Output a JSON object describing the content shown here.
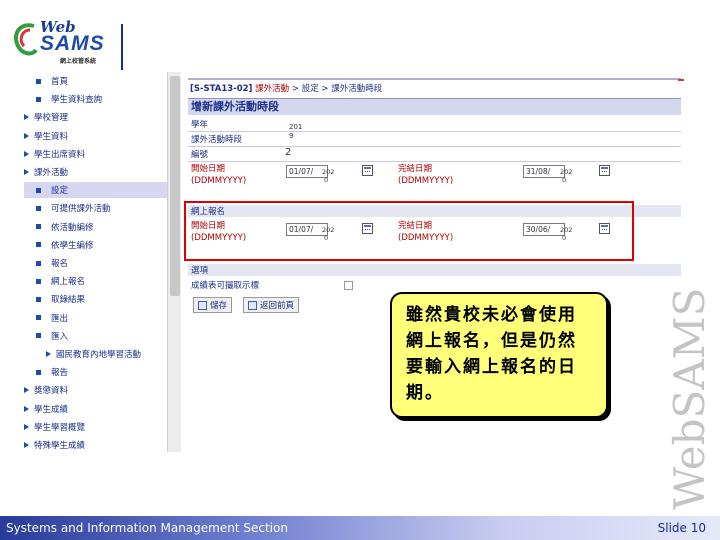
{
  "logo": {
    "web": "Web",
    "sams": "SAMS",
    "sub": "網上校管系統"
  },
  "sidebar": {
    "items": [
      {
        "label": "首頁",
        "marker": "square",
        "indent": 1
      },
      {
        "label": "學生資料查詢",
        "marker": "square",
        "indent": 1
      },
      {
        "label": "學校管理",
        "marker": "triangle",
        "indent": 0
      },
      {
        "label": "學生資料",
        "marker": "triangle",
        "indent": 0
      },
      {
        "label": "學生出席資料",
        "marker": "triangle",
        "indent": 0
      },
      {
        "label": "課外活動",
        "marker": "triangle",
        "indent": 0
      },
      {
        "label": "設定",
        "marker": "square",
        "indent": 1,
        "active": true
      },
      {
        "label": "可提供課外活動",
        "marker": "square",
        "indent": 1
      },
      {
        "label": "依活動編修",
        "marker": "square",
        "indent": 1
      },
      {
        "label": "依學生編修",
        "marker": "square",
        "indent": 1
      },
      {
        "label": "報名",
        "marker": "square",
        "indent": 1
      },
      {
        "label": "網上報名",
        "marker": "square",
        "indent": 1
      },
      {
        "label": "取錄結果",
        "marker": "square",
        "indent": 1
      },
      {
        "label": "匯出",
        "marker": "square",
        "indent": 1
      },
      {
        "label": "匯入",
        "marker": "square",
        "indent": 1
      },
      {
        "label": "國民教育內地學習活動",
        "marker": "triangle",
        "indent": 2
      },
      {
        "label": "報告",
        "marker": "square",
        "indent": 1
      },
      {
        "label": "獎懲資料",
        "marker": "triangle",
        "indent": 0
      },
      {
        "label": "學生成績",
        "marker": "triangle",
        "indent": 0
      },
      {
        "label": "學生學習概覽",
        "marker": "triangle",
        "indent": 0
      },
      {
        "label": "特殊學生成績",
        "marker": "triangle",
        "indent": 0
      }
    ]
  },
  "breadcrumb": {
    "code": "[S-STA13-02]",
    "section": "課外活動",
    "rest": "> 設定 > 課外活動時段"
  },
  "form": {
    "title": "增新課外活動時段",
    "school_year_label": "學年",
    "school_year_value_1": "201",
    "school_year_value_2": "9",
    "period_label": "課外活動時段",
    "number_label": "編號",
    "number_value": "2",
    "start_label": "開始日期",
    "format_label": "(DDMMYYYY)",
    "end_label": "完結日期",
    "start_date_value": "01/07/",
    "start_date_small_1": "202",
    "start_date_small_2": "0",
    "end_date_value": "31/08/",
    "end_date_small_1": "202",
    "end_date_small_2": "0",
    "online_section_label": "網上報名",
    "online_start_value": "01/07/",
    "online_end_value": "30/06/",
    "online_start_small_1": "202",
    "online_start_small_2": "0",
    "online_end_small_1": "202",
    "online_end_small_2": "0",
    "other_section_label": "選項",
    "other_option_label": "成績表可撮取示標",
    "save_button": "儲存",
    "back_button": "返回前頁"
  },
  "callout": {
    "text": "雖然貴校未必會使用網上報名，但是仍然要輸入網上報名的日期。"
  },
  "brand_vertical": "WebSAMS",
  "footer": {
    "left": "Systems and Information Management Section",
    "right": "Slide 10"
  },
  "colors": {
    "accent": "#1a2f8a",
    "required_red": "#b00000",
    "highlight_box": "#e00000",
    "callout_bg": "#ffff7a"
  }
}
